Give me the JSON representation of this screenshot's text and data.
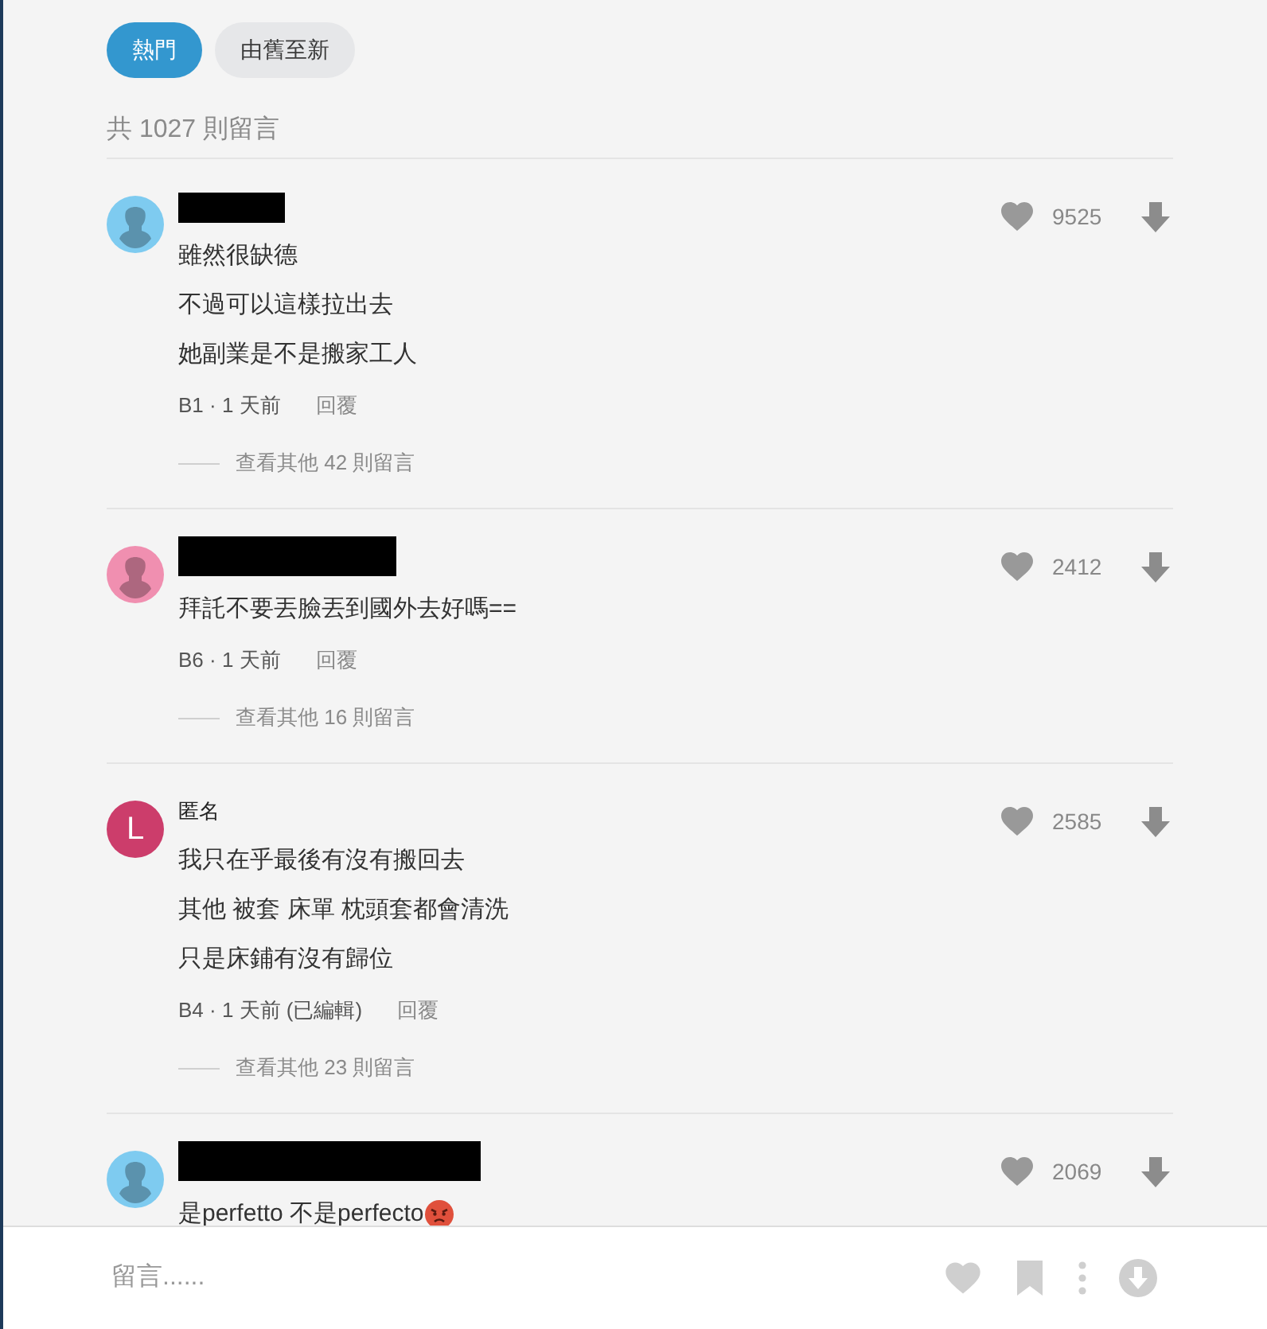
{
  "sort_tabs": [
    {
      "label": "熱門",
      "selected": true
    },
    {
      "label": "由舊至新",
      "selected": false
    }
  ],
  "comment_count": "共 1027 則留言",
  "comments": [
    {
      "avatar": {
        "kind": "silhouette",
        "color": "#7ecbf0"
      },
      "author": {
        "kind": "redacted"
      },
      "lines": [
        "雖然很缺德",
        "不過可以這樣拉出去",
        "她副業是不是搬家工人"
      ],
      "meta": "B1 · 1 天前",
      "reply": "回覆",
      "likes": "9525",
      "more_replies": "查看其他 42 則留言"
    },
    {
      "avatar": {
        "kind": "silhouette",
        "color": "#f08fb0"
      },
      "author": {
        "kind": "redacted"
      },
      "lines": [
        "拜託不要丟臉丟到國外去好嗎=="
      ],
      "meta": "B6 · 1 天前",
      "reply": "回覆",
      "likes": "2412",
      "more_replies": "查看其他 16 則留言"
    },
    {
      "avatar": {
        "kind": "letter",
        "text": "L",
        "color": "#cc3d6b"
      },
      "author": {
        "kind": "name",
        "text": "匿名"
      },
      "lines": [
        "我只在乎最後有沒有搬回去",
        "其他 被套 床單 枕頭套都會清洗",
        "只是床鋪有沒有歸位"
      ],
      "meta": "B4 · 1 天前 (已編輯)",
      "reply": "回覆",
      "likes": "2585",
      "more_replies": "查看其他 23 則留言"
    },
    {
      "avatar": {
        "kind": "silhouette",
        "color": "#7ecbf0"
      },
      "author": {
        "kind": "redacted"
      },
      "lines": [
        "是perfetto 不是perfecto"
      ],
      "emoji": true,
      "likes": "2069"
    }
  ],
  "comment_box": {
    "placeholder": "留言......"
  }
}
